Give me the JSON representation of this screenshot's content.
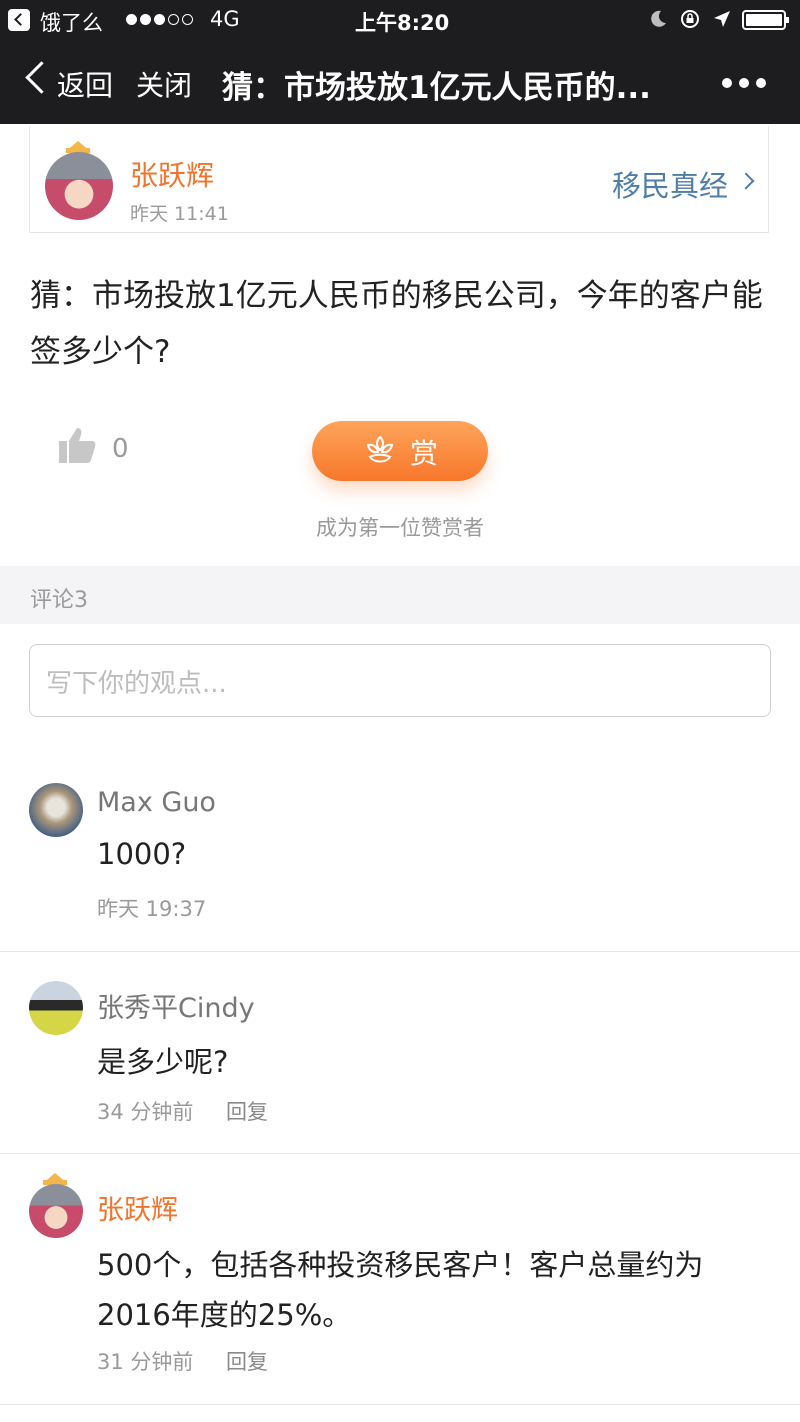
{
  "status_bar": {
    "back_app": "饿了么",
    "network": "4G",
    "time": "上午8:20"
  },
  "nav": {
    "back": "返回",
    "close": "关闭",
    "title": "猜：市场投放1亿元人民币的...",
    "more_icon": "more-dots-icon"
  },
  "author": {
    "name": "张跃辉",
    "time": "昨天 11:41",
    "tag": "移民真经"
  },
  "post": {
    "text": "猜：市场投放1亿元人民币的移民公司，今年的客户能签多少个?"
  },
  "actions": {
    "like_count": "0",
    "reward_label": "赏",
    "first_reward_text": "成为第一位赞赏者"
  },
  "comments_header": "评论3",
  "comment_input": {
    "placeholder": "写下你的观点..."
  },
  "comments": [
    {
      "name": "Max Guo",
      "text": "1000?",
      "time": "昨天 19:37",
      "reply": ""
    },
    {
      "name": "张秀平Cindy",
      "text": "是多少呢?",
      "time": "34 分钟前",
      "reply": "回复"
    },
    {
      "name": "张跃辉",
      "text": "500个，包括各种投资移民客户！客户总量约为2016年度的25%。",
      "time": "31 分钟前",
      "reply": "回复"
    }
  ],
  "colors": {
    "nav_bg": "#1d1d1f",
    "accent_orange": "#f2732b",
    "tag_blue": "#4f7ea8"
  }
}
